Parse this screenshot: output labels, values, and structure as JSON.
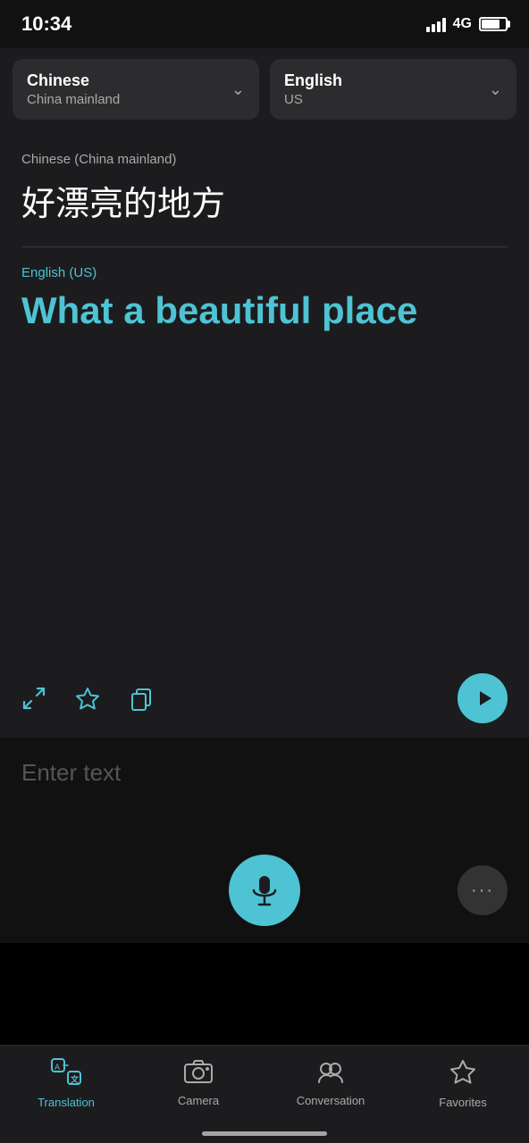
{
  "statusBar": {
    "time": "10:34",
    "network": "4G"
  },
  "languageBar": {
    "source": {
      "name": "Chinese",
      "region": "China mainland"
    },
    "target": {
      "name": "English",
      "region": "US"
    }
  },
  "translation": {
    "sourceLangLabel": "Chinese (China mainland)",
    "sourceText": "好漂亮的地方",
    "targetLangLabel": "English (US)",
    "targetText": "What a beautiful place"
  },
  "input": {
    "placeholder": "Enter text"
  },
  "tabs": [
    {
      "id": "translation",
      "label": "Translation",
      "active": true
    },
    {
      "id": "camera",
      "label": "Camera",
      "active": false
    },
    {
      "id": "conversation",
      "label": "Conversation",
      "active": false
    },
    {
      "id": "favorites",
      "label": "Favorites",
      "active": false
    }
  ]
}
